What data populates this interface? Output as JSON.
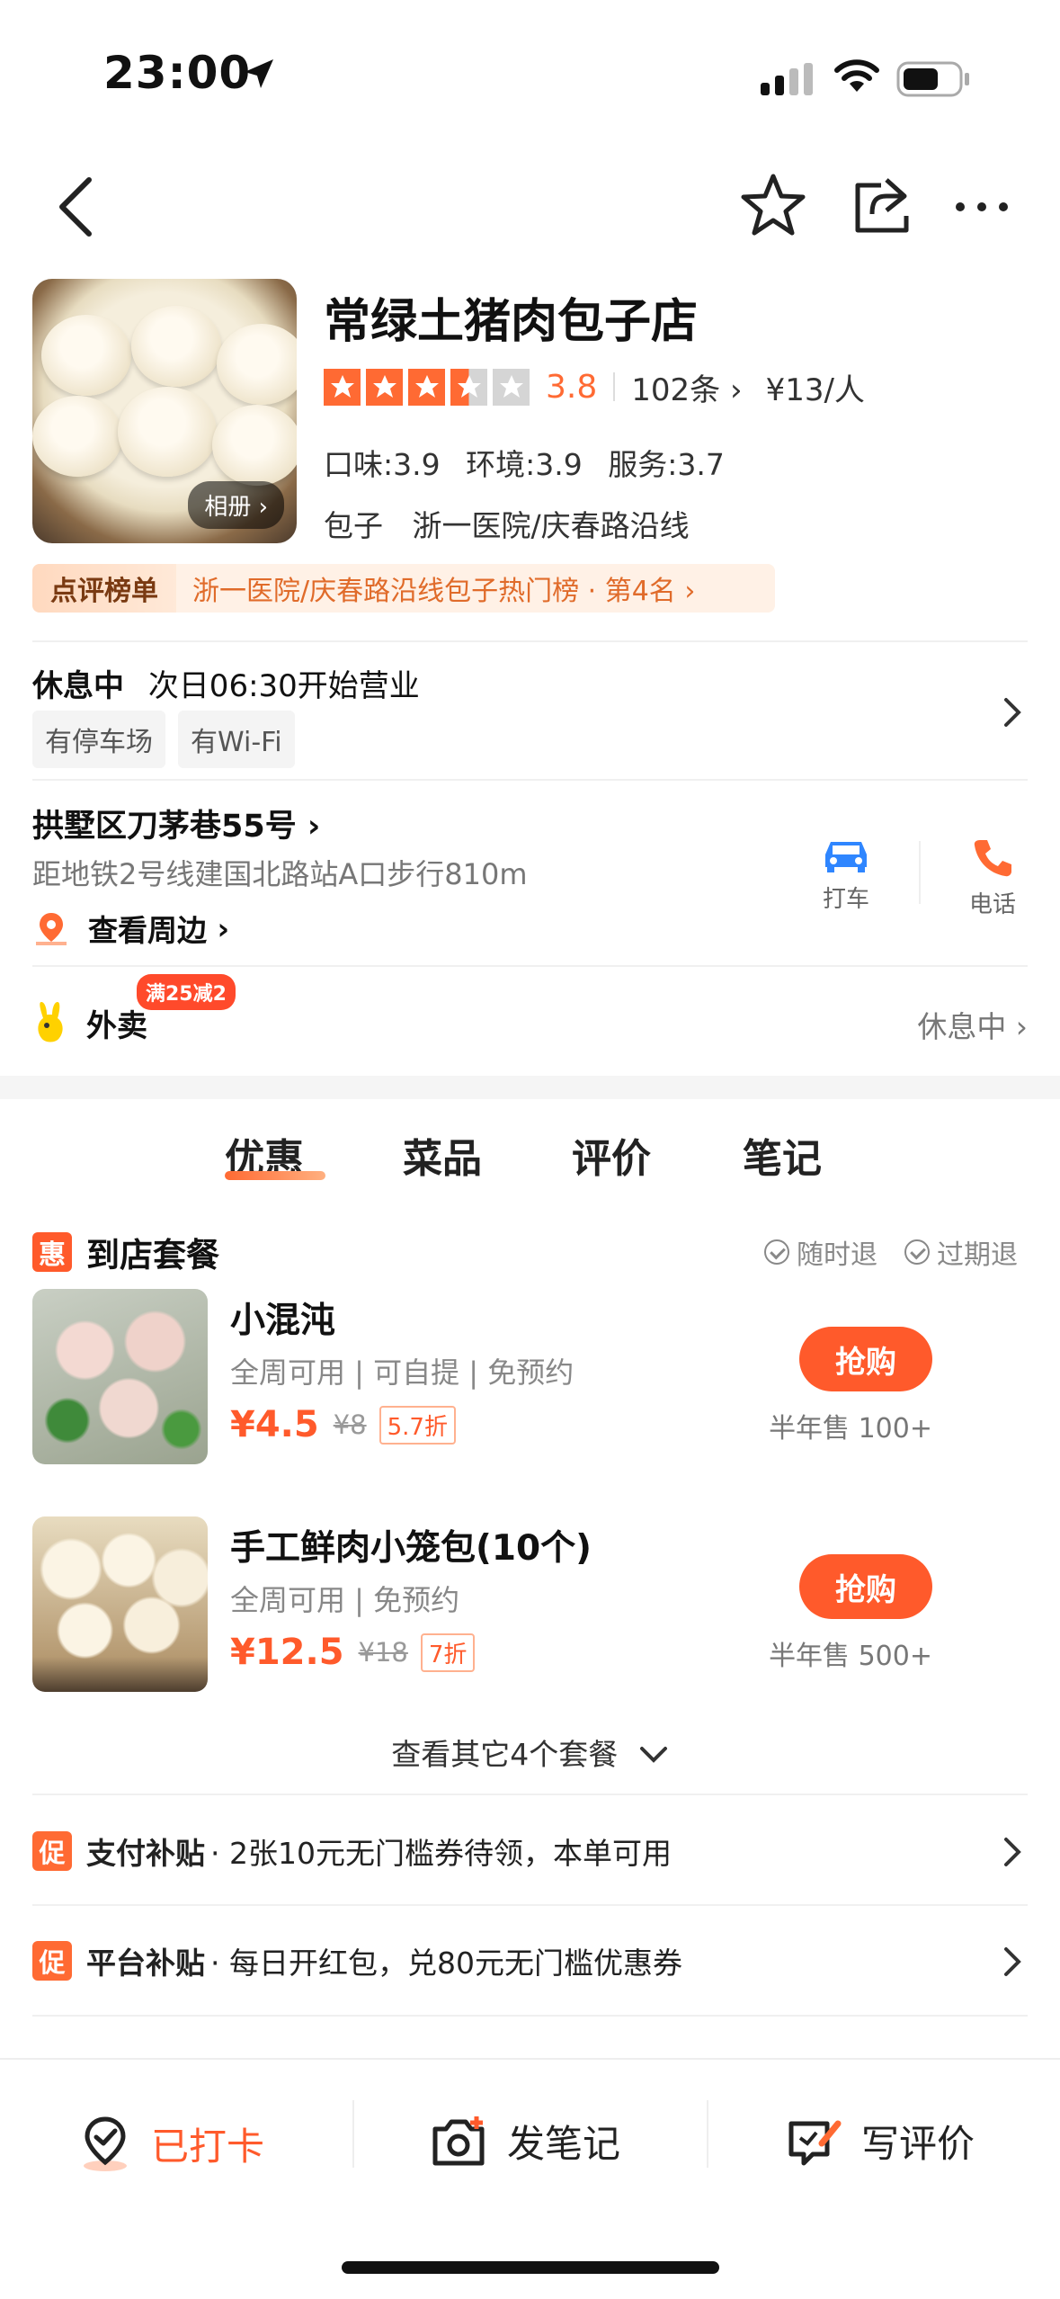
{
  "status_bar": {
    "time": "23:00"
  },
  "shop": {
    "name": "常绿土猪肉包子店",
    "rating": "3.8",
    "stars": 3.5,
    "review_count": "102条",
    "price_per_person": "¥13/人",
    "album_label": "相册",
    "subscores": [
      "口味:3.9",
      "环境:3.9",
      "服务:3.7"
    ],
    "category": "包子",
    "area": "浙一医院/庆春路沿线"
  },
  "rank": {
    "tag": "点评榜单",
    "text": "浙一医院/庆春路沿线包子热门榜 · 第4名"
  },
  "hours": {
    "status": "休息中",
    "next_open": "次日06:30开始营业",
    "tags": [
      "有停车场",
      "有Wi-Fi"
    ]
  },
  "address": {
    "line": "拱墅区刀茅巷55号",
    "subway": "距地铁2号线建国北路站A口步行810m",
    "nearby_label": "查看周边",
    "taxi_label": "打车",
    "phone_label": "电话"
  },
  "takeaway": {
    "label": "外卖",
    "badge": "满25减2",
    "status": "休息中"
  },
  "tabs": [
    "优惠",
    "菜品",
    "评价",
    "笔记"
  ],
  "deals_section": {
    "icon_char": "惠",
    "title": "到店套餐",
    "guarantees": [
      "随时退",
      "过期退"
    ]
  },
  "deals": [
    {
      "title": "小混沌",
      "sub": "全周可用 | 可自提 | 免预约",
      "price": "¥4.5",
      "orig": "¥8",
      "discount": "5.7折",
      "buy": "抢购",
      "sold": "半年售 100+"
    },
    {
      "title": "手工鲜肉小笼包(10个)",
      "sub": "全周可用 | 免预约",
      "price": "¥12.5",
      "orig": "¥18",
      "discount": "7折",
      "buy": "抢购",
      "sold": "半年售 500+"
    }
  ],
  "more_deals": "查看其它4个套餐",
  "promos": [
    {
      "icon_char": "促",
      "title": "支付补贴",
      "text": "· 2张10元无门槛券待领，本单可用"
    },
    {
      "icon_char": "促",
      "title": "平台补贴",
      "text": "· 每日开红包，兑80元无门槛优惠券"
    }
  ],
  "bottom_bar": {
    "checkin": "已打卡",
    "note": "发笔记",
    "review": "写评价"
  },
  "colors": {
    "accent": "#ff5a2b",
    "star": "#ff6a33"
  }
}
